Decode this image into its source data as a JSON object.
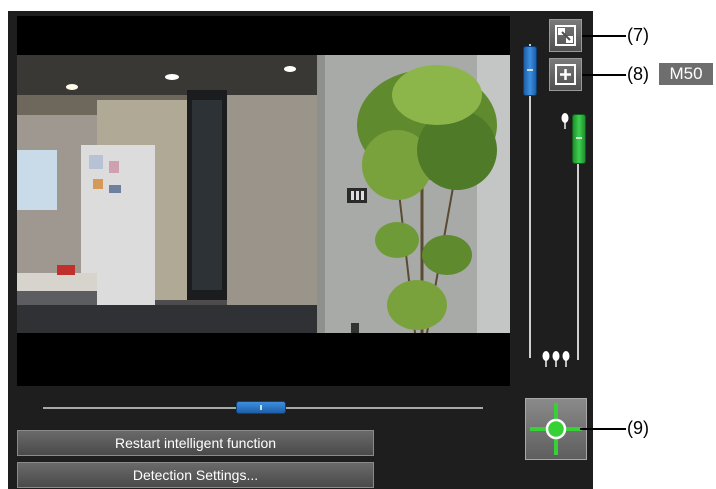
{
  "buttons": {
    "restart": "Restart intelligent function",
    "detection": "Detection Settings..."
  },
  "callouts": {
    "c7": "(7)",
    "c8": "(8)",
    "c9": "(9)"
  },
  "model_badge": "M50",
  "icons": [
    "full-view-icon",
    "zoom-in-icon",
    "near-focus-icon",
    "far-focus-icon",
    "center-target-icon"
  ],
  "colors": {
    "zoom_thumb": "#3c8fe0",
    "focus_thumb": "#3fd04e",
    "panel": "#1e1e1e",
    "button": "#5a5a5a",
    "center_target": "#35d135"
  }
}
